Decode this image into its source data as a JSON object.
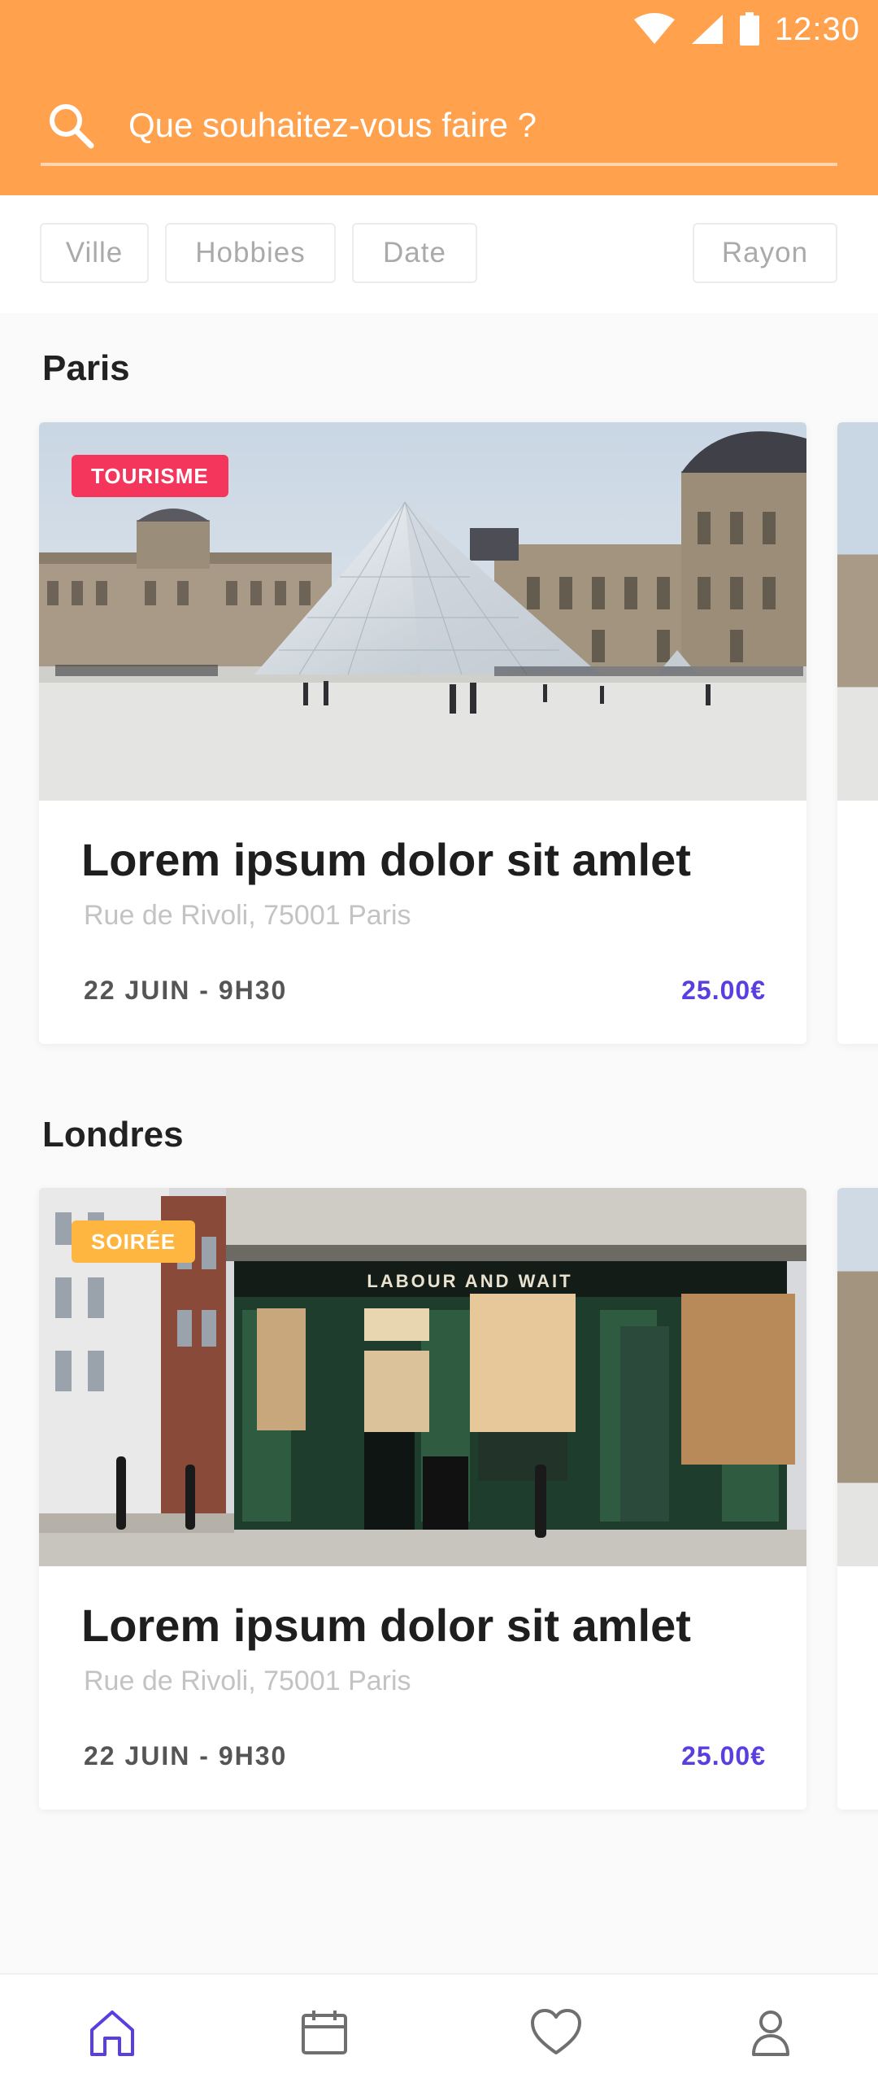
{
  "status_bar": {
    "time": "12:30"
  },
  "search": {
    "placeholder": "Que souhaitez-vous faire ?"
  },
  "filters": [
    "Ville",
    "Hobbies",
    "Date",
    "Rayon"
  ],
  "sections": [
    {
      "title": "Paris",
      "card": {
        "badge": "TOURISME",
        "badge_color": "#f5365c",
        "title": "Lorem ipsum dolor sit amlet",
        "address": "Rue de Rivoli, 75001 Paris",
        "date": "22 JUIN - 9H30",
        "price": "25.00€"
      }
    },
    {
      "title": "Londres",
      "card": {
        "badge": "SOIRÉE",
        "badge_color": "#ffb640",
        "title": "Lorem ipsum dolor sit amlet",
        "address": "Rue de Rivoli, 75001 Paris",
        "date": "22 JUIN - 9H30",
        "price": "25.00€"
      }
    }
  ],
  "colors": {
    "header": "#ffa14d",
    "price": "#5b3ee0",
    "nav_active": "#5b3ee0",
    "nav_inactive": "#6f6f6f"
  },
  "bottom_nav": [
    {
      "icon": "home-icon",
      "active": true
    },
    {
      "icon": "calendar-icon",
      "active": false
    },
    {
      "icon": "heart-icon",
      "active": false
    },
    {
      "icon": "profile-icon",
      "active": false
    }
  ]
}
